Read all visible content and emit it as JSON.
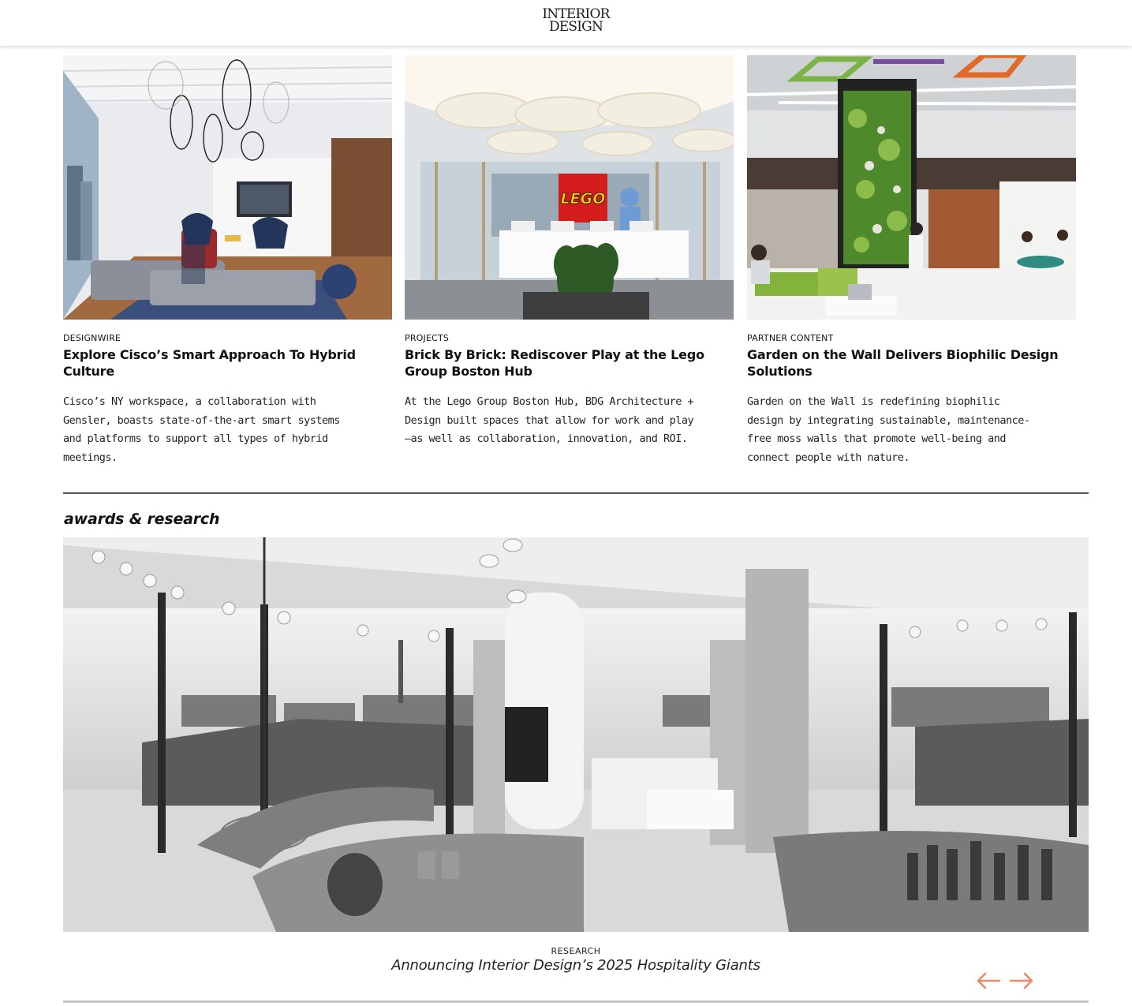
{
  "header": {
    "logo_line1": "INTERIOR",
    "logo_line2": "DESIGN"
  },
  "cards": [
    {
      "kicker": "DESIGNWIRE",
      "title": "Explore Cisco’s Smart Approach To Hybrid Culture",
      "description": "Cisco’s NY workspace, a collaboration with Gensler, boasts state-of-the-art smart systems and platforms to support all types of hybrid meetings."
    },
    {
      "kicker": "PROJECTS",
      "title": "Brick By Brick: Rediscover Play at the Lego Group Boston Hub",
      "description": "At the Lego Group Boston Hub, BDG Architecture + Design built spaces that allow for work and play—as well as collaboration, innovation, and ROI.",
      "image_sign": "LEGO"
    },
    {
      "kicker": "PARTNER CONTENT",
      "title": "Garden on the Wall Delivers Biophilic Design Solutions",
      "description": "Garden on the Wall is redefining biophilic design by integrating sustainable, maintenance-free moss walls that promote well-being and connect people with nature."
    }
  ],
  "awards": {
    "heading": "awards & research",
    "feature": {
      "kicker": "RESEARCH",
      "title": "Announcing Interior Design’s 2025 Hospitality Giants"
    },
    "carousel": {
      "prev_icon": "arrow-left-icon",
      "next_icon": "arrow-right-icon",
      "arrow_color": "#e8896b"
    }
  }
}
